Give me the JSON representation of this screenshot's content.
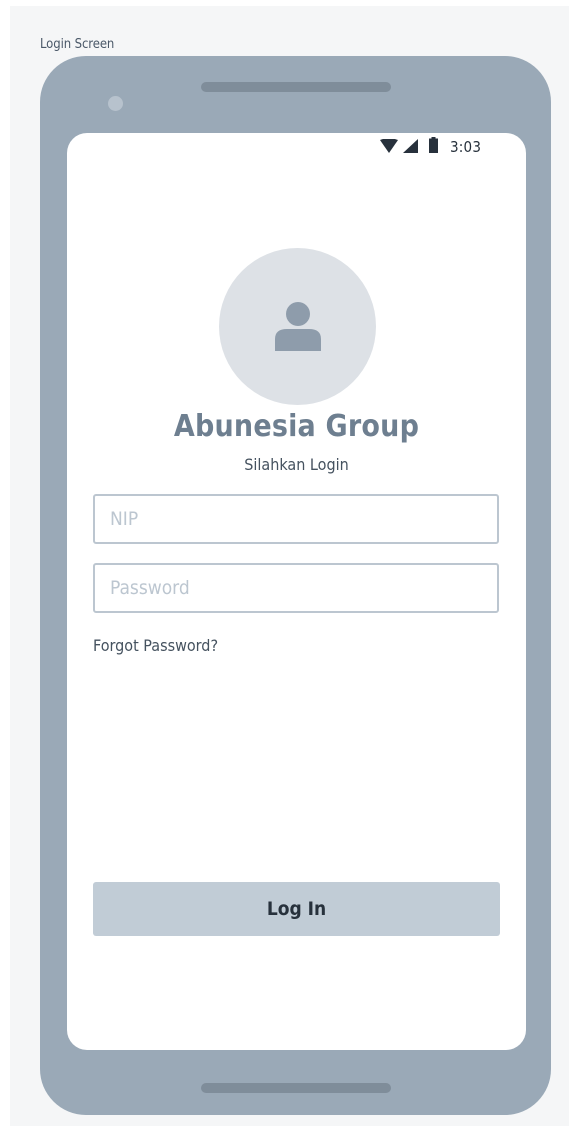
{
  "screen_label": "Login Screen",
  "status_bar": {
    "time": "3:03",
    "icons": [
      "wifi-icon",
      "cellular-signal-icon",
      "battery-icon"
    ]
  },
  "avatar": {
    "icon": "user-icon"
  },
  "company_name": "Abunesia Group",
  "subtitle": "Silahkan Login",
  "form": {
    "nip": {
      "placeholder": "NIP",
      "value": ""
    },
    "password": {
      "placeholder": "Password",
      "value": ""
    },
    "forgot_password_label": "Forgot Password?",
    "login_button_label": "Log In"
  },
  "colors": {
    "device_frame": "#9aa9b7",
    "avatar_background": "#dde1e6",
    "company_name_text": "#6e7f90",
    "input_border": "#bcc6d0",
    "login_button_background": "#c1ccd6"
  }
}
